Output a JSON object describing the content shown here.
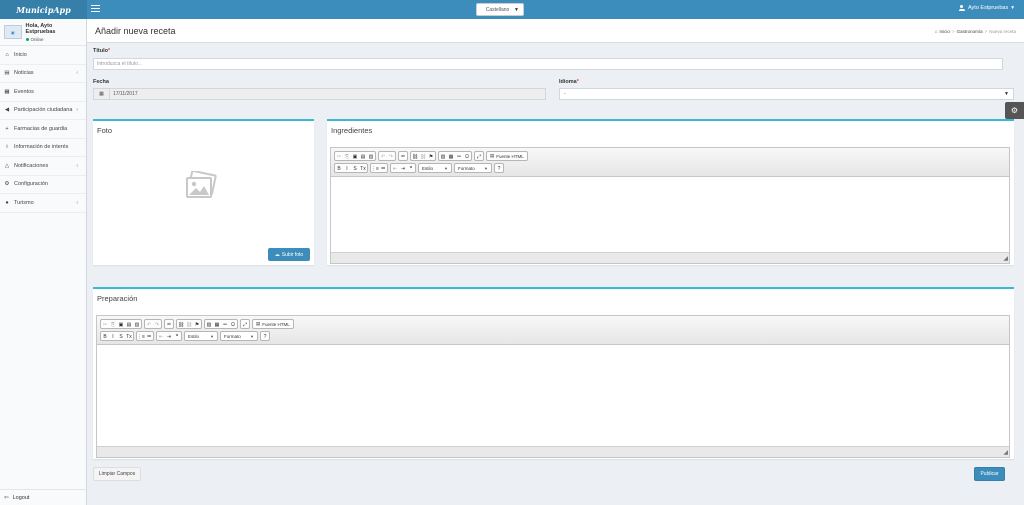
{
  "app": {
    "logo": "MunicipApp"
  },
  "topbar": {
    "language": "Castellano",
    "user": "Ayto Estpruebas"
  },
  "sidebar": {
    "greeting": "Hola, Ayto Estpruebas",
    "status": "Online",
    "items": [
      {
        "label": "Inicio",
        "icon": "home-icon",
        "glyph": "⌂",
        "chevron": false
      },
      {
        "label": "Noticias",
        "icon": "newspaper-icon",
        "glyph": "▤",
        "chevron": true
      },
      {
        "label": "Eventos",
        "icon": "calendar-icon",
        "glyph": "▦",
        "chevron": false
      },
      {
        "label": "Participación ciudadana",
        "icon": "megaphone-icon",
        "glyph": "◀",
        "chevron": true
      },
      {
        "label": "Farmacias de guardia",
        "icon": "plus-icon",
        "glyph": "+",
        "chevron": false
      },
      {
        "label": "Información de interés",
        "icon": "info-icon",
        "glyph": "i",
        "chevron": false
      },
      {
        "label": "Notificaciones",
        "icon": "bell-icon",
        "glyph": "△",
        "chevron": true
      },
      {
        "label": "Configuración",
        "icon": "cogs-icon",
        "glyph": "⚙",
        "chevron": false
      },
      {
        "label": "Turismo",
        "icon": "globe-icon",
        "glyph": "●",
        "chevron": true
      }
    ],
    "logout": "Logout"
  },
  "header": {
    "title": "Añadir nueva receta",
    "breadcrumb": [
      "Inicio",
      "Gastronomía",
      "Nueva receta"
    ]
  },
  "form": {
    "title_label": "Título",
    "title_placeholder": "Introduzca el título...",
    "date_label": "Fecha",
    "date_value": "17/11/2017",
    "language_label": "Idioma",
    "language_value": "-",
    "required_mark": "*"
  },
  "photo": {
    "title": "Foto",
    "upload_label": "Subir foto"
  },
  "ingredients": {
    "title": "Ingredientes"
  },
  "preparation": {
    "title": "Preparación"
  },
  "editor": {
    "source_label": "Fuente HTML",
    "style_label": "Estilo",
    "format_label": "Formato"
  },
  "actions": {
    "clear": "Limpiar Campos",
    "publish": "Publicar"
  },
  "colors": {
    "header": "#3c8dbc",
    "accent": "#3cb8d2",
    "required": "#dd4b39"
  }
}
